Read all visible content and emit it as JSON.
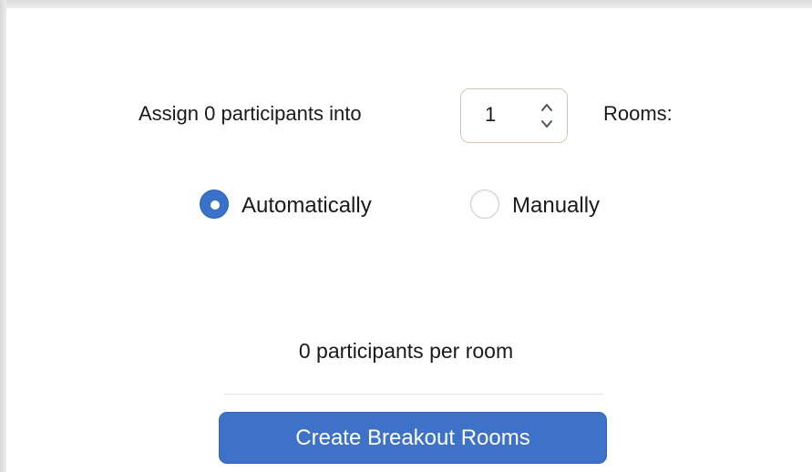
{
  "assign": {
    "prefix": "Assign 0 participants into",
    "rooms_value": "1",
    "suffix": "Rooms:"
  },
  "distribution": {
    "options": [
      {
        "label": "Automatically",
        "checked": true
      },
      {
        "label": "Manually",
        "checked": false
      }
    ]
  },
  "summary": {
    "per_room": "0 participants per room"
  },
  "actions": {
    "create_label": "Create Breakout Rooms"
  },
  "colors": {
    "accent": "#3d72c8",
    "text": "#1a1a1a"
  }
}
